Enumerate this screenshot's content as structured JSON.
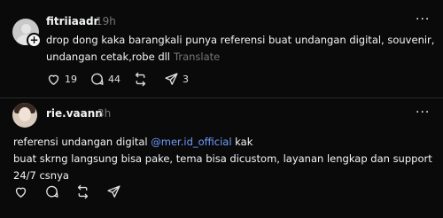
{
  "posts": [
    {
      "username": "fitriiaadr",
      "time": "19h",
      "lines": [
        "drop dong kaka barangkali punya referensi buat undangan digital, souvenir,",
        "undangan cetak,robe dll"
      ],
      "translate_label": "Translate",
      "more_label": "···",
      "actions": {
        "likes": "19",
        "replies": "44",
        "reposts": "",
        "shares": "3"
      }
    },
    {
      "username": "rie.vaann",
      "time": "3h",
      "line1_before": "referensi undangan digital ",
      "mention": "@mer.id_official",
      "line1_after": " kak",
      "line2": "buat skrng langsung bisa pake, tema bisa dicustom, layanan lengkap dan support",
      "line3": "24/7 csnya",
      "more_label": "···",
      "actions": {
        "likes": "",
        "replies": "",
        "reposts": "",
        "shares": ""
      }
    }
  ],
  "icons": {
    "like": "heart-icon",
    "reply": "comment-icon",
    "repost": "repost-icon",
    "share": "send-icon",
    "follow": "plus-icon"
  }
}
